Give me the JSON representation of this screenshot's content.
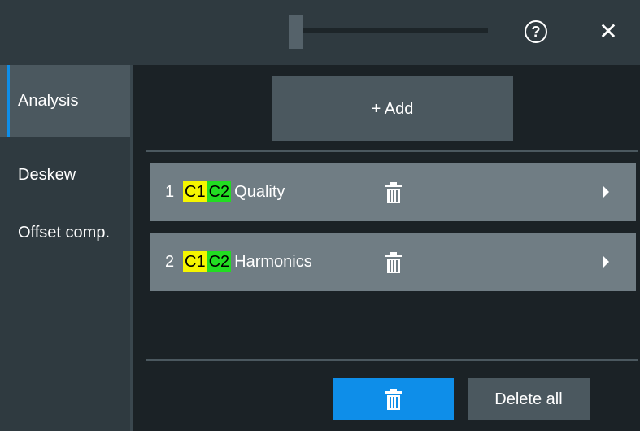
{
  "titlebar": {
    "help_icon": "question-circle-icon",
    "close_icon": "close-x-icon",
    "help_label": "?",
    "close_label": "✕"
  },
  "sidebar": {
    "items": [
      {
        "label": "Analysis",
        "active": true
      },
      {
        "label": "Deskew",
        "active": false
      },
      {
        "label": "Offset comp.",
        "active": false
      }
    ]
  },
  "main": {
    "add_label": "+ Add",
    "rows": [
      {
        "index": "1",
        "channels": [
          "C1",
          "C2"
        ],
        "title": "Quality"
      },
      {
        "index": "2",
        "channels": [
          "C1",
          "C2"
        ],
        "title": "Harmonics"
      }
    ],
    "delete_all_label": "Delete all"
  },
  "colors": {
    "accent": "#0e8ee9",
    "c1": "#f6f600",
    "c2": "#22dd22"
  }
}
